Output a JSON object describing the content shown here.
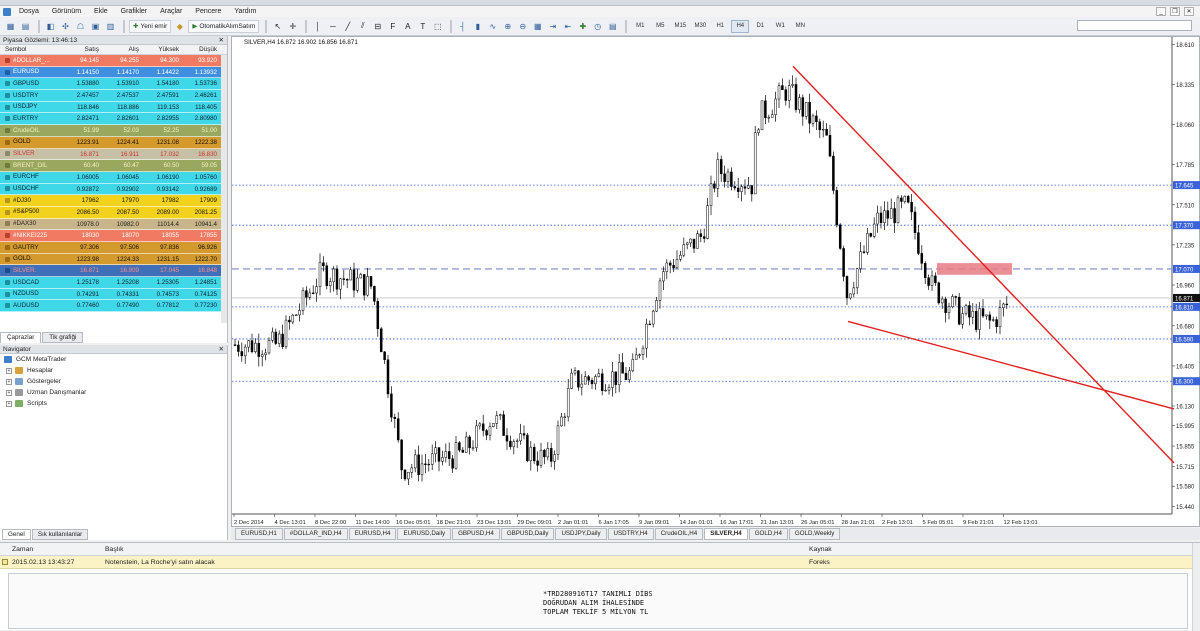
{
  "menu": [
    "Dosya",
    "Görünüm",
    "Ekle",
    "Grafikler",
    "Araçlar",
    "Pencere",
    "Yardım"
  ],
  "toolbar": {
    "new_order": "Yeni emir",
    "autotrade": "OtomatikAlımSatım",
    "timeframes": [
      "M1",
      "M5",
      "M15",
      "M30",
      "H1",
      "H4",
      "D1",
      "W1",
      "MN"
    ],
    "active_tf": "H4"
  },
  "market_watch": {
    "title": "Piyasa Gözlemi: 13:46:13",
    "columns": [
      "Sembol",
      "Satış",
      "Alış",
      "Yüksek",
      "Düşük"
    ],
    "rows": [
      {
        "sym": "#DOLLAR_...",
        "bid": "94.145",
        "ask": "94.255",
        "high": "94.300",
        "low": "93.920",
        "bg": "#f07a62",
        "fg": "#ffffff",
        "ar": "#b8412c"
      },
      {
        "sym": "EURUSD",
        "bid": "1.14150",
        "ask": "1.14170",
        "high": "1.14422",
        "low": "1.13932",
        "bg": "#3f8fe0",
        "fg": "#ffffff",
        "ar": "#1d5ea8"
      },
      {
        "sym": "GBPUSD",
        "bid": "1.53880",
        "ask": "1.53910",
        "high": "1.54180",
        "low": "1.53736",
        "bg": "#3fd8e8",
        "fg": "#102030",
        "ar": "#1d8e9c"
      },
      {
        "sym": "USDTRY",
        "bid": "2.47457",
        "ask": "2.47537",
        "high": "2.47591",
        "low": "2.46261",
        "bg": "#3fd8e8",
        "fg": "#102030",
        "ar": "#1d8e9c"
      },
      {
        "sym": "USDJPY",
        "bid": "118.846",
        "ask": "118.886",
        "high": "119.153",
        "low": "118.405",
        "bg": "#3fd8e8",
        "fg": "#102030",
        "ar": "#1d8e9c"
      },
      {
        "sym": "EURTRY",
        "bid": "2.82471",
        "ask": "2.82601",
        "high": "2.82955",
        "low": "2.80980",
        "bg": "#3fd8e8",
        "fg": "#102030",
        "ar": "#1d8e9c"
      },
      {
        "sym": "CrudeOIL",
        "bid": "51.99",
        "ask": "52.03",
        "high": "52.25",
        "low": "51.00",
        "bg": "#9aa85f",
        "fg": "#f4f1c0",
        "ar": "#6c7a3b"
      },
      {
        "sym": "GOLD",
        "bid": "1223.91",
        "ask": "1224.41",
        "high": "1231.08",
        "low": "1222.38",
        "bg": "#d59a2e",
        "fg": "#111111",
        "ar": "#9c6a12"
      },
      {
        "sym": "SILVER",
        "bid": "16.871",
        "ask": "16.911",
        "high": "17.032",
        "low": "16.830",
        "bg": "#c5c0a6",
        "fg": "#d03030",
        "ar": "#8c8870"
      },
      {
        "sym": "BRENT_OIL",
        "bid": "60.40",
        "ask": "60.47",
        "high": "60.50",
        "low": "59.05",
        "bg": "#9aa85f",
        "fg": "#f4f1c0",
        "ar": "#6c7a3b"
      },
      {
        "sym": "EURCHF",
        "bid": "1.06005",
        "ask": "1.06045",
        "high": "1.06190",
        "low": "1.05760",
        "bg": "#3fd8e8",
        "fg": "#102030",
        "ar": "#1d8e9c"
      },
      {
        "sym": "USDCHF",
        "bid": "0.92872",
        "ask": "0.92902",
        "high": "0.93142",
        "low": "0.92689",
        "bg": "#3fd8e8",
        "fg": "#102030",
        "ar": "#1d8e9c"
      },
      {
        "sym": "#DJ30",
        "bid": "17962",
        "ask": "17970",
        "high": "17982",
        "low": "17909",
        "bg": "#f3d21e",
        "fg": "#111111",
        "ar": "#b5961a"
      },
      {
        "sym": "#S&P500",
        "bid": "2086.50",
        "ask": "2087.50",
        "high": "2089.00",
        "low": "2081.25",
        "bg": "#f3d21e",
        "fg": "#111111",
        "ar": "#b5961a"
      },
      {
        "sym": "#DAX30",
        "bid": "10978.0",
        "ask": "10982.0",
        "high": "11014.4",
        "low": "10941.4",
        "bg": "#c8b58a",
        "fg": "#222222",
        "ar": "#8f7c52"
      },
      {
        "sym": "#NIKKEI225",
        "bid": "18030",
        "ask": "18070",
        "high": "18055",
        "low": "17855",
        "bg": "#f07a62",
        "fg": "#ffffff",
        "ar": "#b8412c"
      },
      {
        "sym": "GAUTRY",
        "bid": "97.306",
        "ask": "97.506",
        "high": "97.836",
        "low": "96.926",
        "bg": "#d59a2e",
        "fg": "#111111",
        "ar": "#9c6a12"
      },
      {
        "sym": "GOLD.",
        "bid": "1223.98",
        "ask": "1224.33",
        "high": "1231.15",
        "low": "1222.70",
        "bg": "#d59a2e",
        "fg": "#111111",
        "ar": "#9c6a12"
      },
      {
        "sym": "SILVER.",
        "bid": "16.871",
        "ask": "16.909",
        "high": "17.045",
        "low": "16.848",
        "bg": "#3f6fb8",
        "fg": "#ff8a8a",
        "ar": "#1f4a88"
      },
      {
        "sym": "USDCAD",
        "bid": "1.25178",
        "ask": "1.25208",
        "high": "1.25305",
        "low": "1.24851",
        "bg": "#3fd8e8",
        "fg": "#102030",
        "ar": "#1d8e9c"
      },
      {
        "sym": "NZDUSD",
        "bid": "0.74291",
        "ask": "0.74331",
        "high": "0.74573",
        "low": "0.74125",
        "bg": "#3fd8e8",
        "fg": "#102030",
        "ar": "#1d8e9c"
      },
      {
        "sym": "AUDUSD",
        "bid": "0.77460",
        "ask": "0.77490",
        "high": "0.77812",
        "low": "0.77230",
        "bg": "#3fd8e8",
        "fg": "#102030",
        "ar": "#1d8e9c"
      }
    ],
    "tabs": [
      "Çaprazlar",
      "Tik grafiği"
    ]
  },
  "navigator": {
    "title": "Navigator",
    "root": "GCM MetaTrader",
    "items": [
      "Hesaplar",
      "Göstergeler",
      "Uzman Danışmanlar",
      "Scripts"
    ],
    "tabs": [
      "Genel",
      "Sık kullanılanlar"
    ]
  },
  "chart": {
    "info": "SILVER,H4  16.872 16.902 16.856 16.871",
    "price_labels": [
      "18.610",
      "18.335",
      "18.060",
      "17.785",
      "17.645",
      "17.510",
      "17.370",
      "17.235",
      "17.070",
      "16.960",
      "16.871",
      "16.810",
      "16.680",
      "16.590",
      "16.405",
      "16.300",
      "16.130",
      "15.995",
      "15.855",
      "15.715",
      "15.580",
      "15.440"
    ],
    "highlight_labels": [
      "17.645",
      "17.370",
      "17.070",
      "16.871",
      "16.810",
      "16.590",
      "16.300"
    ],
    "time_labels": [
      "2 Dec 2014",
      "4 Dec 13:01",
      "8 Dec 22:00",
      "11 Dec 14:00",
      "16 Dec 05:01",
      "18 Dec 21:01",
      "23 Dec 13:01",
      "29 Dec 09:01",
      "2 Jan 01:01",
      "6 Jan 17:05",
      "9 Jan 09:01",
      "14 Jan 01:01",
      "16 Jan 17:01",
      "21 Jan 13:01",
      "26 Jan 05:01",
      "28 Jan 21:01",
      "2 Feb 13:01",
      "5 Feb 05:01",
      "9 Feb 21:01",
      "12 Feb 13:01"
    ],
    "colors": {
      "trend": "#e02020",
      "hline": "#2a5be8",
      "dashed": "#7b86c8",
      "box": "#e87a82"
    }
  },
  "chart_tabs": [
    "EURUSD,H1",
    "#DOLLAR_IND,H4",
    "EURUSD,H4",
    "EURUSD,Daily",
    "GBPUSD,H4",
    "GBPUSD,Daily",
    "USDJPY,Daily",
    "USDTRY,H4",
    "CrudeOIL,H4",
    "SILVER,H4",
    "GOLD,H4",
    "GOLD,Weekly"
  ],
  "active_chart_tab": "SILVER,H4",
  "news": {
    "columns": [
      "Zaman",
      "Başlık",
      "Kaynak"
    ],
    "row": {
      "time": "2015.02.13 13:43:27",
      "title": "Notenstein, La Roche'yi satın alacak",
      "source": "Foreks"
    },
    "body": "*TRD280916T17 TANIMLI DİBS\nDOĞRUDAN ALIM İHALESİNDE\nTOPLAM TEKLİF 5 MİLYON TL"
  }
}
